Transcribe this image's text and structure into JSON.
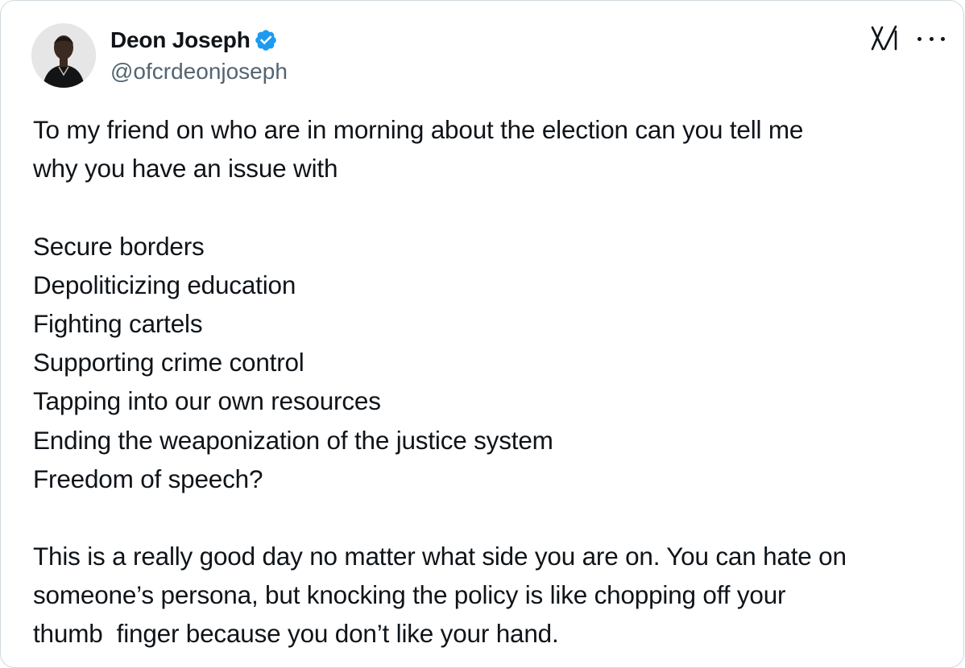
{
  "author": {
    "display_name": "Deon Joseph",
    "handle": "@ofcrdeonjoseph",
    "verified": true,
    "verified_color": "#1d9bf0"
  },
  "icons": {
    "avatar": "profile-photo",
    "verified": "verified-badge-icon",
    "brand": "x-logo-icon",
    "more": "more-options-icon"
  },
  "tweet": {
    "lines": [
      "To my friend on who are in morning about the election can you tell me",
      "why you have an issue with",
      "",
      "Secure borders",
      "Depoliticizing education",
      "Fighting cartels",
      "Supporting crime control",
      "Tapping into our own resources",
      "Ending the weaponization of the justice system",
      "Freedom of speech?",
      "",
      "This is a really good day no matter what side you are on. You can hate on",
      "someone’s persona, but knocking the policy is like chopping off your",
      "thumb  finger because you don’t like your hand."
    ]
  }
}
